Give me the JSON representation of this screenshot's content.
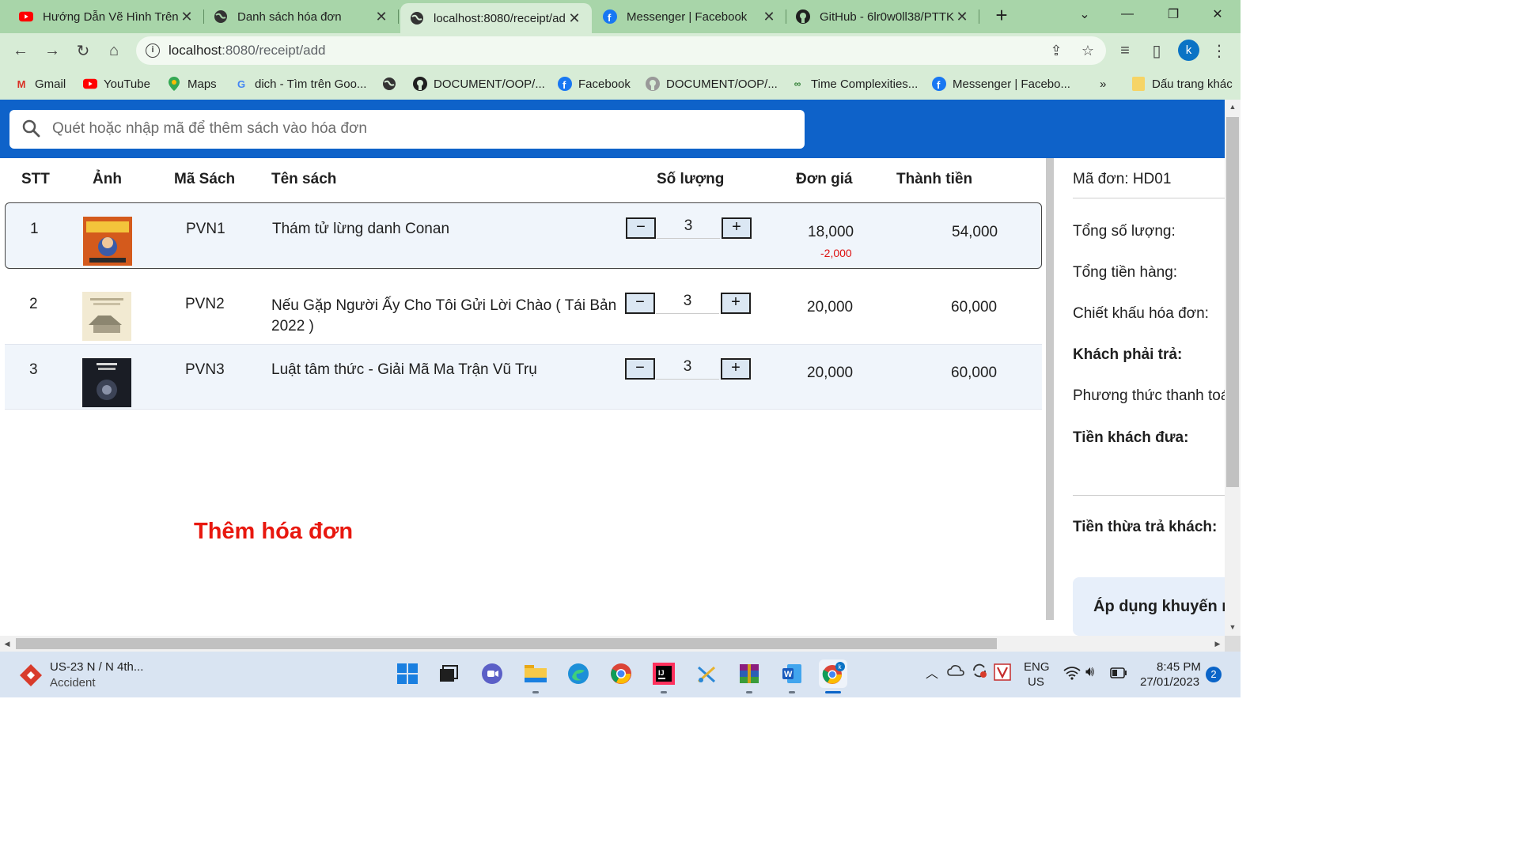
{
  "browser": {
    "tabs": [
      {
        "title": "Hướng Dẫn Vẽ Hình Trên",
        "icon": "youtube-icon"
      },
      {
        "title": "Danh sách hóa đơn",
        "icon": "globe-icon"
      },
      {
        "title": "localhost:8080/receipt/ad",
        "icon": "globe-icon"
      },
      {
        "title": "Messenger | Facebook",
        "icon": "facebook-icon"
      },
      {
        "title": "GitHub - 6lr0w0ll38/PTTK",
        "icon": "github-icon"
      }
    ],
    "url_host": "localhost",
    "url_rest": ":8080/receipt/add",
    "avatar_letter": "k",
    "bookmarks": [
      {
        "label": "Gmail"
      },
      {
        "label": "YouTube"
      },
      {
        "label": "Maps"
      },
      {
        "label": "dich - Tìm trên Goo..."
      },
      {
        "label": ""
      },
      {
        "label": "DOCUMENT/OOP/..."
      },
      {
        "label": "Facebook"
      },
      {
        "label": "DOCUMENT/OOP/..."
      },
      {
        "label": "Time Complexities..."
      },
      {
        "label": "Messenger | Facebo..."
      }
    ],
    "bookmarks_more": "»",
    "other_bookmarks": "Dấu trang khác"
  },
  "search": {
    "placeholder": "Quét hoặc nhập mã để thêm sách vào hóa đơn"
  },
  "table": {
    "headers": {
      "stt": "STT",
      "image": "Ảnh",
      "code": "Mã Sách",
      "name": "Tên sách",
      "qty": "Số lượng",
      "price": "Đơn giá",
      "total": "Thành tiền"
    },
    "rows": [
      {
        "stt": "1",
        "code": "PVN1",
        "name": "Thám tử lừng danh Conan",
        "qty": "3",
        "price": "18,000",
        "discount": "-2,000",
        "total": "54,000"
      },
      {
        "stt": "2",
        "code": "PVN2",
        "name": "Nếu Gặp Người Ấy Cho Tôi Gửi Lời Chào ( Tái Bản 2022 )",
        "qty": "3",
        "price": "20,000",
        "discount": "",
        "total": "60,000"
      },
      {
        "stt": "3",
        "code": "PVN3",
        "name": "Luật tâm thức - Giải Mã Ma Trận Vũ Trụ",
        "qty": "3",
        "price": "20,000",
        "discount": "",
        "total": "60,000"
      }
    ],
    "minus_label": "−",
    "plus_label": "+"
  },
  "add_title": "Thêm hóa đơn",
  "summary": {
    "order_id": "Mã đơn: HD01",
    "total_qty": "Tổng số lượng:",
    "total_goods": "Tổng tiền hàng:",
    "invoice_discount": "Chiết khấu hóa đơn:",
    "customer_pays": "Khách phải trả:",
    "payment_method": "Phương thức thanh toán",
    "cash_given": "Tiền khách đưa:",
    "change": "Tiền thừa trả khách:",
    "promo_button": "Áp dụng khuyến mãi"
  },
  "taskbar": {
    "weather_title": "US-23 N / N 4th...",
    "weather_sub": "Accident",
    "lang": "ENG",
    "region": "US",
    "time": "8:45 PM",
    "date": "27/01/2023",
    "notif_count": "2"
  }
}
